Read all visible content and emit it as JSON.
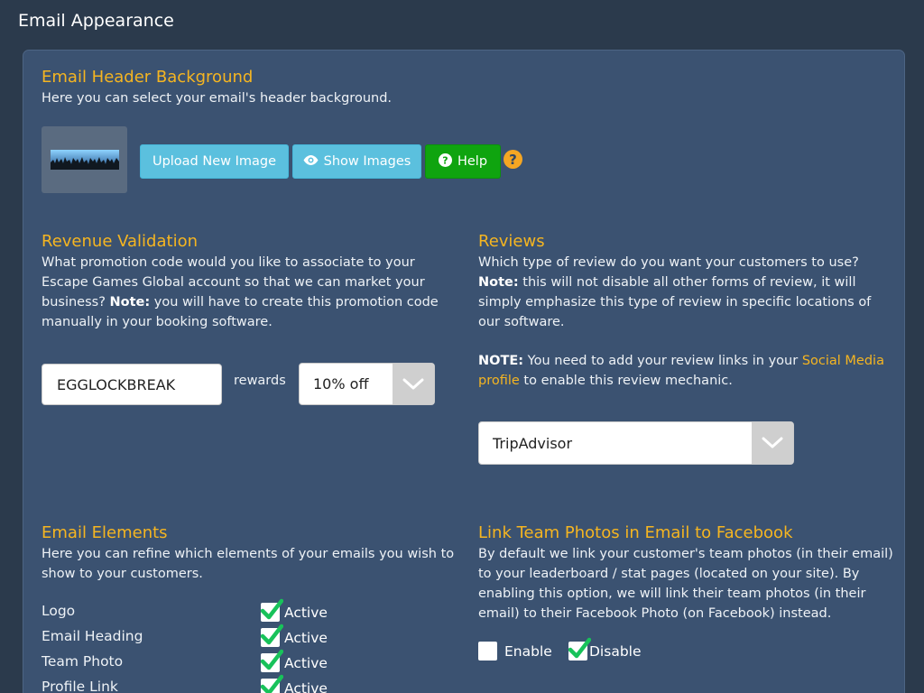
{
  "page": {
    "title": "Email Appearance"
  },
  "header_bg": {
    "title": "Email Header Background",
    "description": "Here you can select your email's header background.",
    "buttons": {
      "upload": "Upload New Image",
      "show": "Show Images",
      "help": "Help"
    },
    "help_icon": "?"
  },
  "revenue": {
    "title": "Revenue Validation",
    "description_1": "What promotion code would you like to associate to your Escape Games Global account so that we can market your business?",
    "note_label": "Note:",
    "description_2": " you will have to create this promotion code manually in your booking software.",
    "promo_code": "EGGLOCKBREAK",
    "rewards_label": "rewards",
    "reward_selected": "10% off"
  },
  "reviews": {
    "title": "Reviews",
    "description_1": "Which type of review do you want your customers to use?",
    "note_label": "Note:",
    "description_2": " this will not disable all other forms of review, it will simply emphasize this type of review in specific locations of our software.",
    "note2_label": "NOTE:",
    "note2_text": " You need to add your review links in your ",
    "note2_link": "Social Media profile",
    "note2_tail": " to enable this review mechanic.",
    "selected": "TripAdvisor"
  },
  "elements": {
    "title": "Email Elements",
    "description": "Here you can refine which elements of your emails you wish to show to your customers.",
    "items": [
      {
        "label": "Logo",
        "status": "Active",
        "checked": true
      },
      {
        "label": "Email Heading",
        "status": "Active",
        "checked": true
      },
      {
        "label": "Team Photo",
        "status": "Active",
        "checked": true
      },
      {
        "label": "Profile Link",
        "status": "Active",
        "checked": true
      }
    ]
  },
  "facebook": {
    "title": "Link Team Photos in Email to Facebook",
    "description": "By default we link your customer's team photos (in their email) to your leaderboard / stat pages (located on your site). By enabling this option, we will link their team photos (in their email) to their Facebook Photo (on Facebook) instead.",
    "enable_label": "Enable",
    "disable_label": "Disable",
    "enable_checked": false,
    "disable_checked": true
  },
  "colors": {
    "accent": "#f5b521",
    "panel": "#3b5271",
    "background": "#2b3a4c",
    "info_button": "#5bc0de",
    "success_button": "#0fa40f",
    "checkmark": "#18c25a"
  },
  "icons": {
    "eye": "eye-icon",
    "help": "question-circle-icon",
    "caret": "chevron-down-icon",
    "check": "checkmark-icon"
  }
}
